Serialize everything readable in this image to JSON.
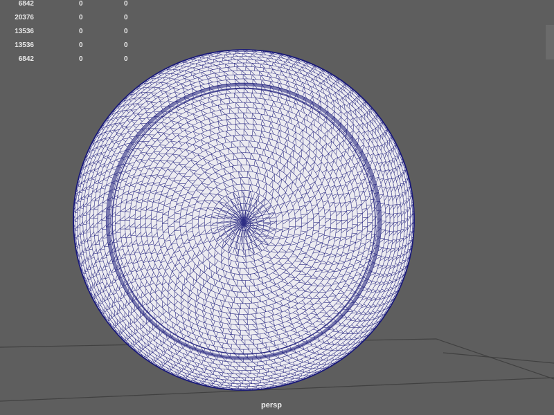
{
  "hud": {
    "rows": [
      [
        "6842",
        "0",
        "0"
      ],
      [
        "20376",
        "0",
        "0"
      ],
      [
        "13536",
        "0",
        "0"
      ],
      [
        "13536",
        "0",
        "0"
      ],
      [
        "6842",
        "0",
        "0"
      ]
    ]
  },
  "viewport": {
    "camera_label": "persp",
    "background_color": "#5e5e5e",
    "wire_color": "#1b1b7a",
    "mesh_fill_color": "#ecebf0"
  }
}
